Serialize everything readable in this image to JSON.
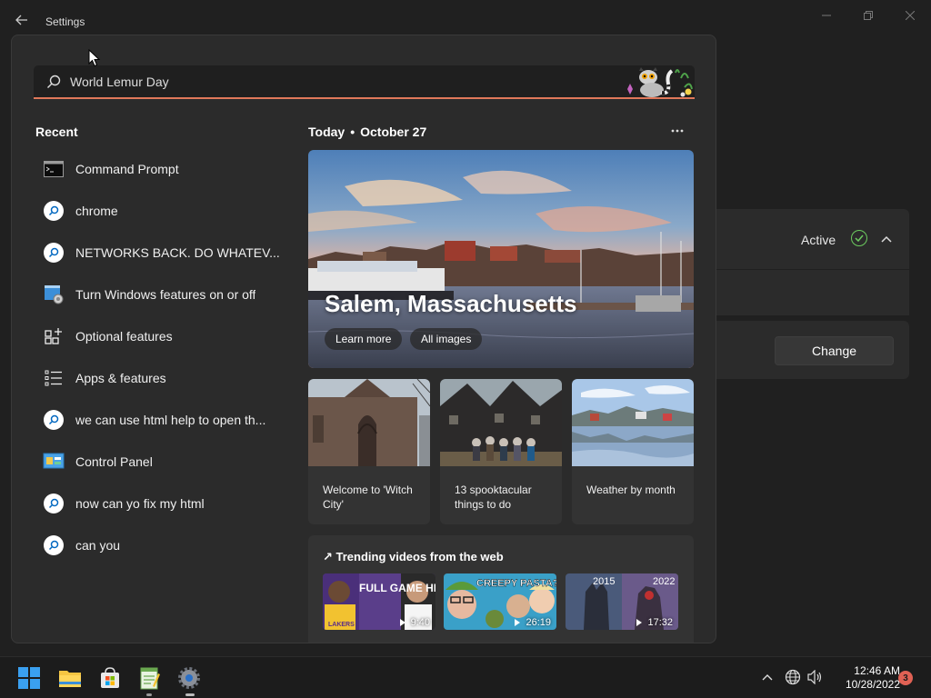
{
  "window": {
    "title": "Settings"
  },
  "background": {
    "status_label": "Active",
    "change_label": "Change"
  },
  "search": {
    "value": "World Lemur Day",
    "placeholder": ""
  },
  "recent": {
    "title": "Recent",
    "items": [
      {
        "label": "Command Prompt",
        "icon": "command-prompt-icon"
      },
      {
        "label": "chrome",
        "icon": "search-icon"
      },
      {
        "label": "NETWORKS BACK. DO WHATEV...",
        "icon": "search-icon"
      },
      {
        "label": "Turn Windows features on or off",
        "icon": "windows-features-icon"
      },
      {
        "label": "Optional features",
        "icon": "optional-features-icon"
      },
      {
        "label": "Apps & features",
        "icon": "apps-list-icon"
      },
      {
        "label": "we can use html help to open th...",
        "icon": "search-icon"
      },
      {
        "label": "Control Panel",
        "icon": "control-panel-icon"
      },
      {
        "label": "now can yo fix my html",
        "icon": "search-icon"
      },
      {
        "label": "can you",
        "icon": "search-icon"
      }
    ]
  },
  "today": {
    "label": "Today",
    "separator": "•",
    "date": "October 27",
    "hero": {
      "title": "Salem, Massachusetts",
      "learn_more": "Learn more",
      "all_images": "All images"
    },
    "cards": [
      {
        "caption": "Welcome to 'Witch City'"
      },
      {
        "caption": "13 spooktacular things to do"
      },
      {
        "caption": "Weather by month"
      }
    ],
    "trending": {
      "title": "↗ Trending videos from the web",
      "videos": [
        {
          "duration": "9:40",
          "overlay": "FULL GAME HIGHLIGHTS",
          "badge": "LAKERS"
        },
        {
          "duration": "26:19",
          "overlay": "CREEPY PASTA?"
        },
        {
          "duration": "17:32",
          "overlay_left": "2015",
          "overlay_right": "2022"
        }
      ]
    }
  },
  "taskbar": {
    "clock_time": "12:46 AM",
    "clock_date": "10/28/2022",
    "notification_count": "3"
  },
  "colors": {
    "accent": "#e0785a",
    "active_green": "#6ccb5f",
    "badge_red": "#e06154"
  }
}
